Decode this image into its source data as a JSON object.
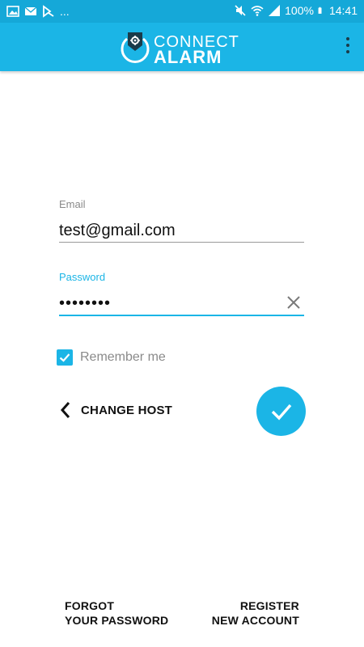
{
  "status_bar": {
    "notification_icons": [
      "image-icon",
      "mail-icon",
      "flag-icon"
    ],
    "more": "...",
    "battery": "100%",
    "time": "14:41"
  },
  "app_bar": {
    "logo_line1": "CONNECT",
    "logo_line2": "ALARM",
    "menu_icon": "more-vert-icon"
  },
  "form": {
    "email": {
      "label": "Email",
      "value": "test@gmail.com"
    },
    "password": {
      "label": "Password",
      "value": "••••••••"
    },
    "remember": {
      "label": "Remember me",
      "checked": true
    },
    "change_host": "CHANGE HOST"
  },
  "footer": {
    "forgot_line1": "FORGOT",
    "forgot_line2": "YOUR PASSWORD",
    "register_line1": "REGISTER",
    "register_line2": "NEW ACCOUNT"
  },
  "colors": {
    "primary": "#1bb5e6",
    "status_bar": "#15a8d8",
    "text": "#111111",
    "hint": "#8a8a8a"
  }
}
